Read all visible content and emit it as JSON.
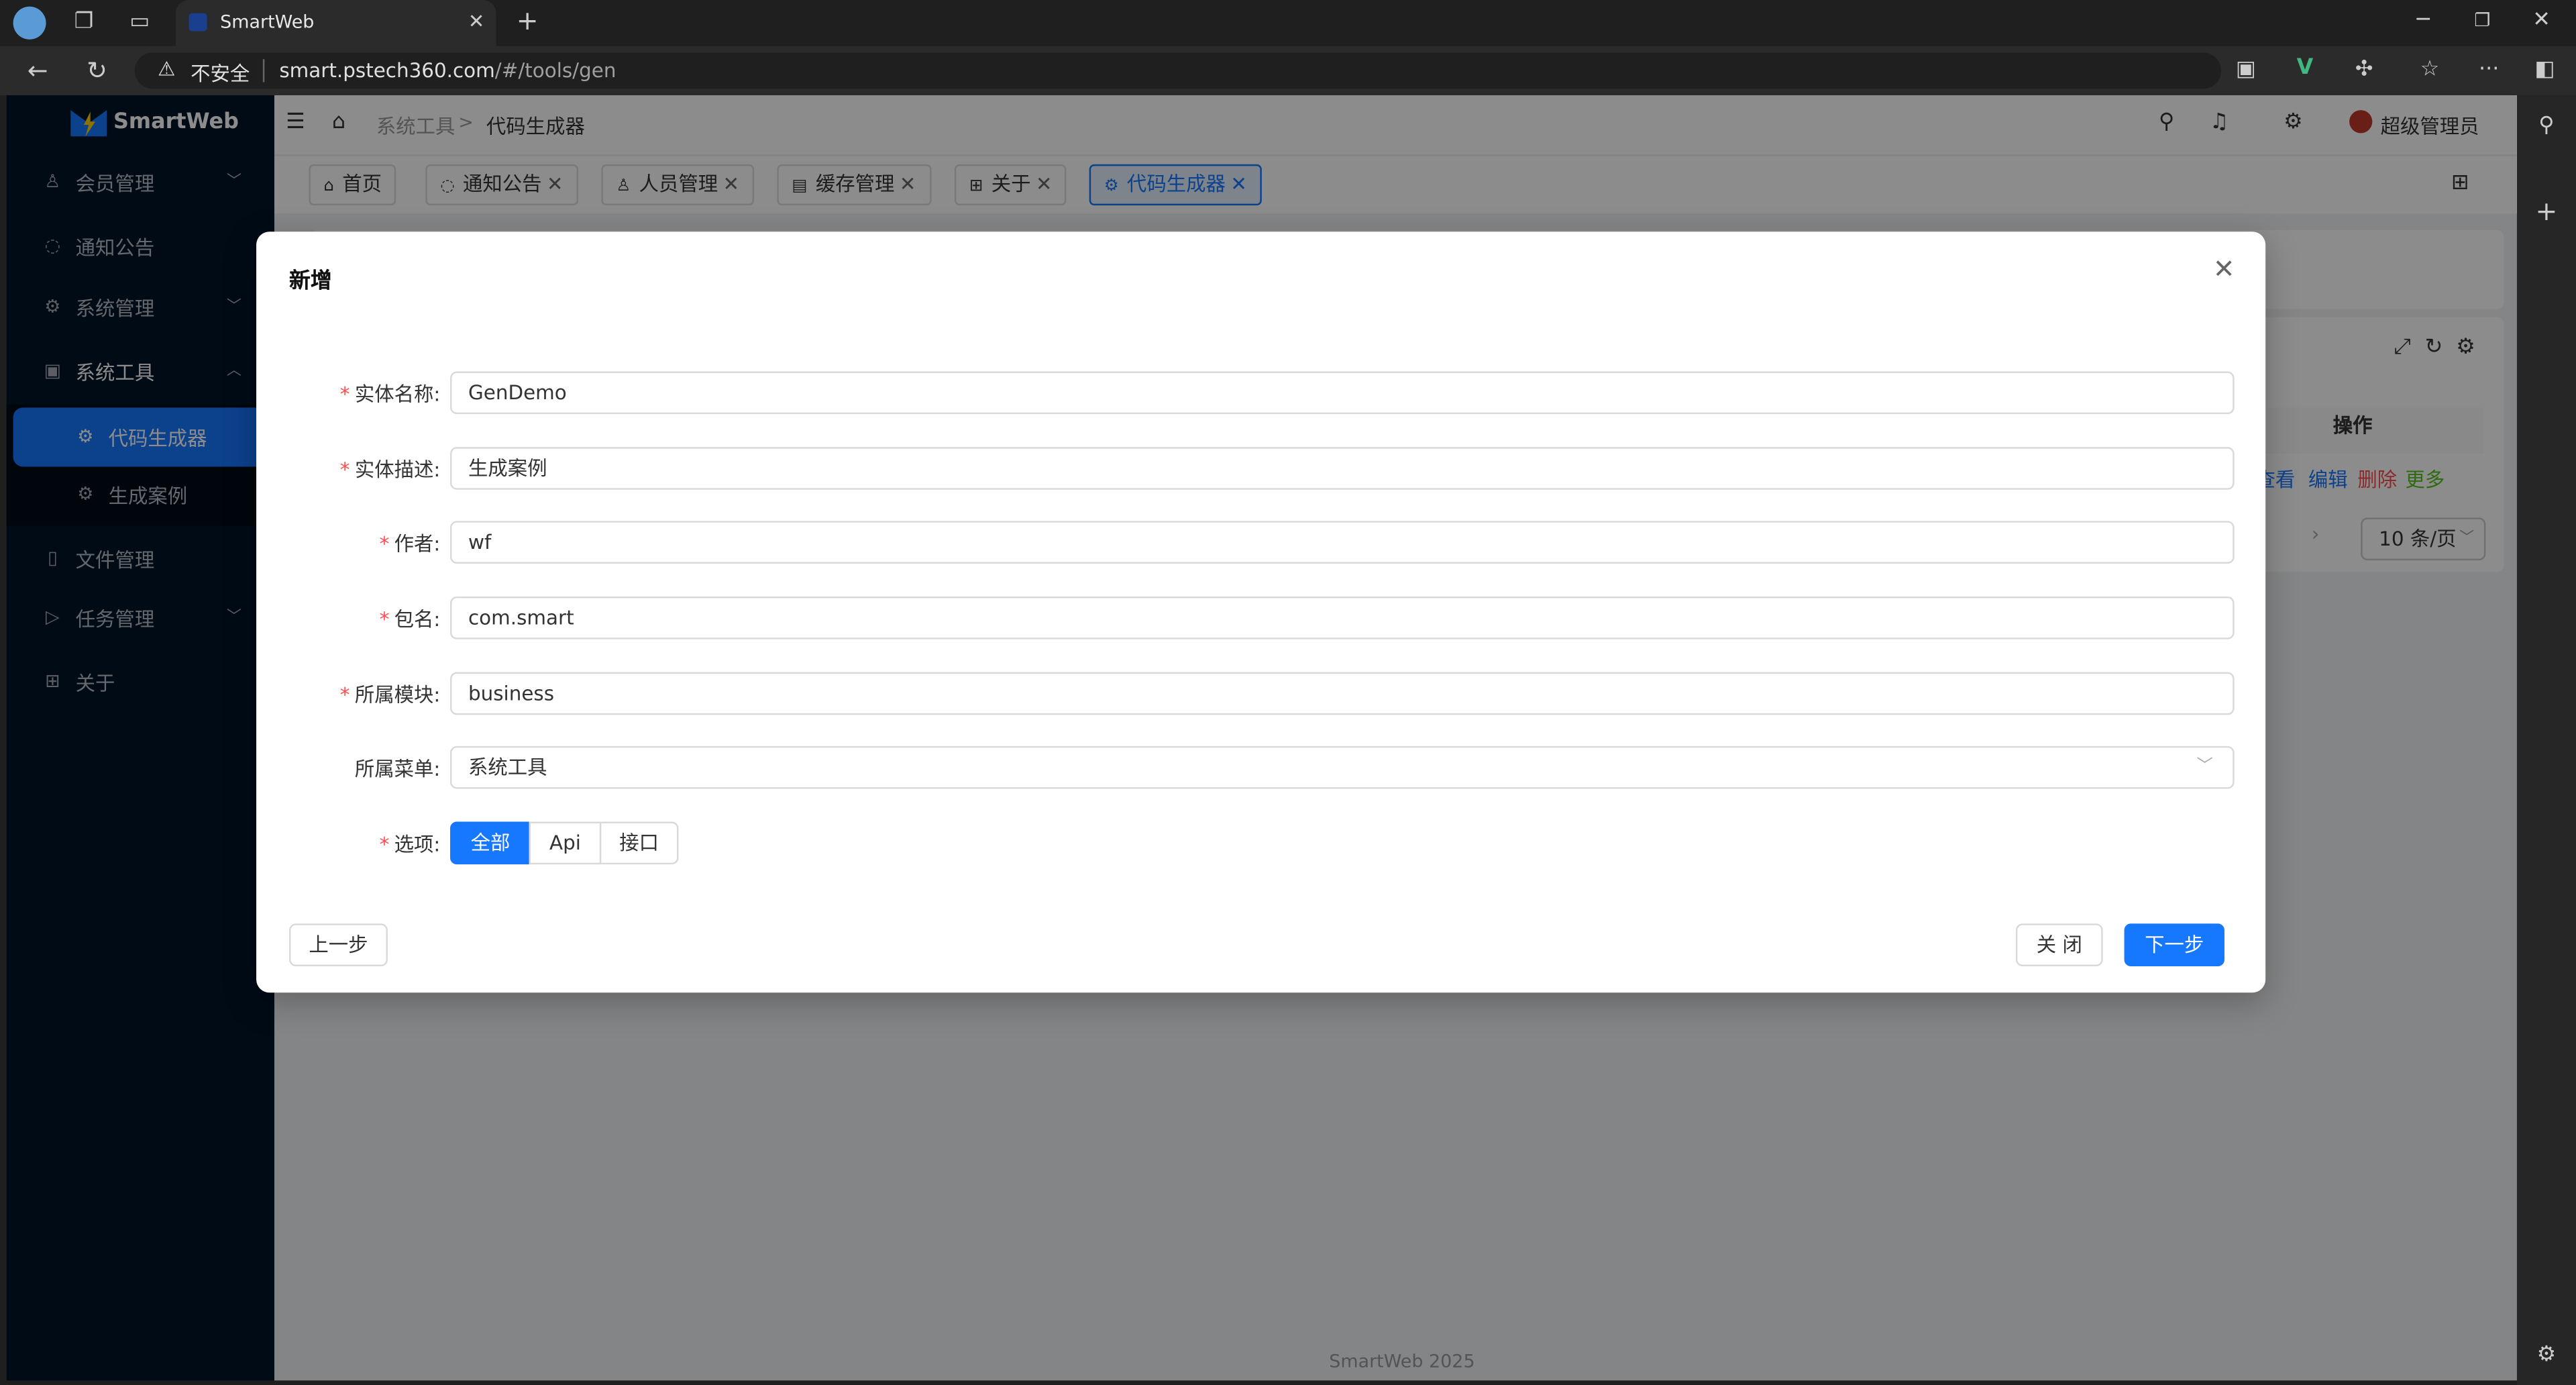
{
  "browser": {
    "tab_title": "SmartWeb",
    "security_label": "不安全",
    "url_host": "smart.pstech360.com",
    "url_path": "/#/tools/gen"
  },
  "app": {
    "name": "SmartWeb",
    "footer": "SmartWeb 2025"
  },
  "sidebar": {
    "items": [
      {
        "label": "会员管理",
        "icon": "user-icon"
      },
      {
        "label": "通知公告",
        "icon": "message-icon"
      },
      {
        "label": "系统管理",
        "icon": "gear-icon"
      },
      {
        "label": "系统工具",
        "icon": "tool-icon"
      },
      {
        "label": "代码生成器",
        "icon": "gear-icon"
      },
      {
        "label": "生成案例",
        "icon": "gear-icon"
      },
      {
        "label": "文件管理",
        "icon": "file-icon"
      },
      {
        "label": "任务管理",
        "icon": "play-icon"
      },
      {
        "label": "关于",
        "icon": "grid-icon"
      }
    ]
  },
  "header": {
    "breadcrumb_parent": "系统工具",
    "breadcrumb_sep": ">",
    "breadcrumb_current": "代码生成器",
    "user": "超级管理员"
  },
  "tabs": [
    {
      "label": "首页"
    },
    {
      "label": "通知公告"
    },
    {
      "label": "人员管理"
    },
    {
      "label": "缓存管理"
    },
    {
      "label": "关于"
    },
    {
      "label": "代码生成器"
    }
  ],
  "table": {
    "ops_header": "操作",
    "ops_links": [
      "查看",
      "编辑",
      "删除",
      "更多"
    ],
    "page_size": "10 条/页"
  },
  "modal": {
    "title": "新增",
    "fields": [
      {
        "label": "实体名称",
        "value": "GenDemo",
        "required": true
      },
      {
        "label": "实体描述",
        "value": "生成案例",
        "required": true
      },
      {
        "label": "作者",
        "value": "wf",
        "required": true
      },
      {
        "label": "包名",
        "value": "com.smart",
        "required": true
      },
      {
        "label": "所属模块",
        "value": "business",
        "required": true
      },
      {
        "label": "所属菜单",
        "value": "系统工具",
        "required": false
      }
    ],
    "options_label": "选项",
    "options": [
      "全部",
      "Api",
      "接口"
    ],
    "options_selected": "全部",
    "prev_button": "上一步",
    "close_button": "关 闭",
    "next_button": "下一步"
  }
}
